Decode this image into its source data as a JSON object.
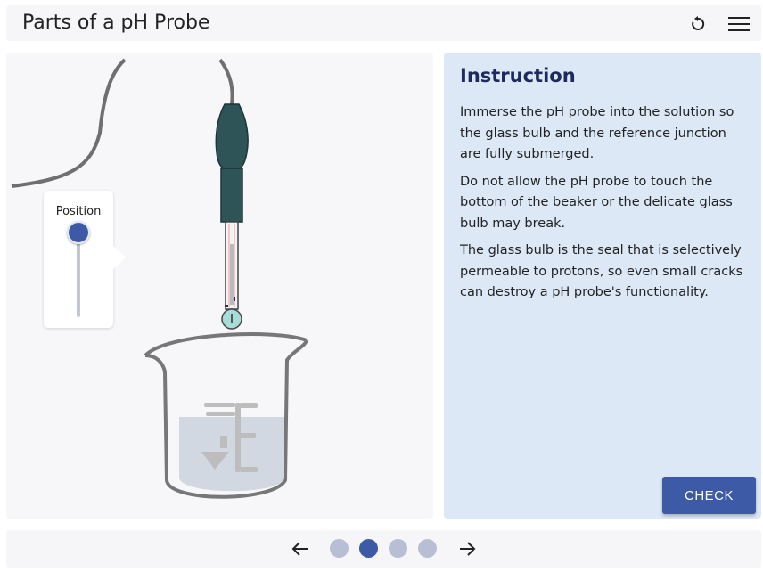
{
  "header": {
    "title": "Parts of a pH Probe"
  },
  "slider": {
    "label": "Position"
  },
  "instruction": {
    "title": "Instruction",
    "paragraphs": [
      "Immerse the pH probe into the solution so the glass bulb and the reference junction are fully submerged.",
      "Do not allow the pH probe to touch the bottom of the beaker or the delicate glass bulb may break.",
      "The glass bulb is the seal that is selectively permeable to protons, so even small cracks can destroy a pH probe's functionality."
    ],
    "check_label": "CHECK"
  },
  "pagination": {
    "total": 4,
    "current": 2
  },
  "colors": {
    "accent": "#3d5aa6",
    "panel": "#dde8f7",
    "probe": "#2f5458"
  }
}
